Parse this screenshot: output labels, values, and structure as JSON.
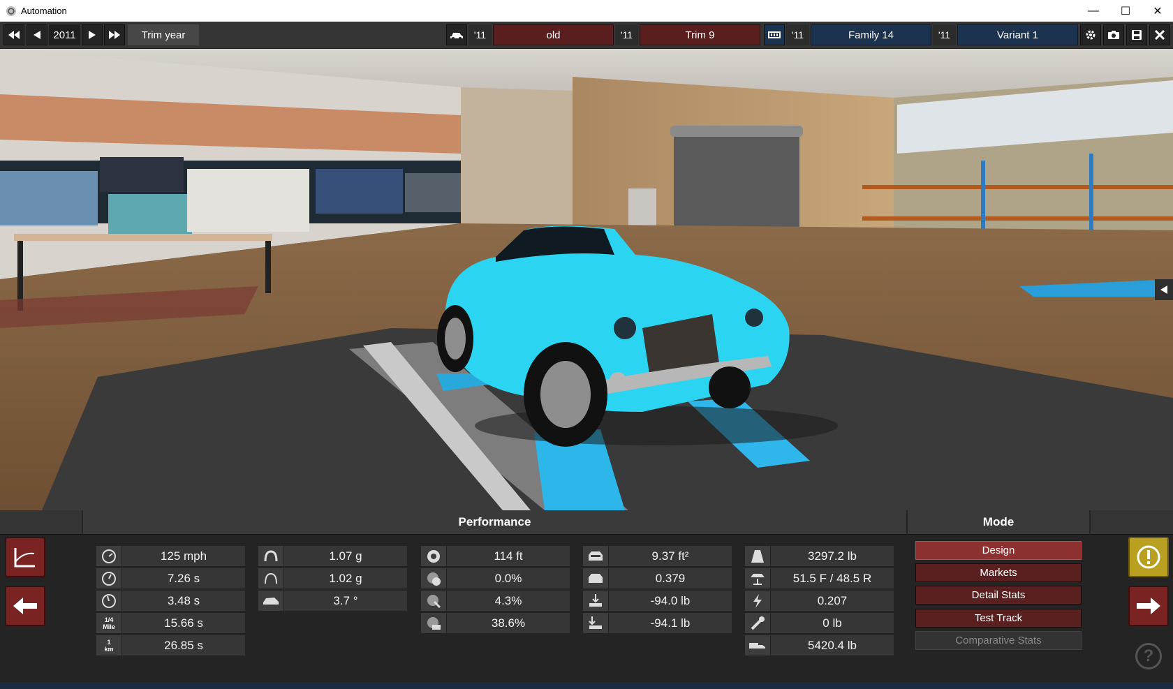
{
  "window": {
    "title": "Automation",
    "controls": {
      "minimize": "—",
      "maximize": "☐",
      "close": "✕"
    }
  },
  "toolbar": {
    "year": "2011",
    "trim_year_label": "Trim year",
    "tags": {
      "t1": "'11",
      "t2": "'11",
      "t3": "'11",
      "t4": "'11"
    },
    "model": "old",
    "trim": "Trim 9",
    "family": "Family 14",
    "variant": "Variant 1"
  },
  "panel": {
    "performance_title": "Performance",
    "mode_title": "Mode",
    "col1": [
      {
        "icon": "top-speed-icon",
        "value": "125 mph"
      },
      {
        "icon": "acceleration-60-icon",
        "value": "7.26 s"
      },
      {
        "icon": "acceleration-40-icon",
        "value": "3.48 s"
      },
      {
        "icon": "quarter-mile-icon",
        "value": "15.66 s",
        "icon_text": "1/4\nMile"
      },
      {
        "icon": "km-time-icon",
        "value": "26.85 s",
        "icon_text": "1\nkm"
      }
    ],
    "col2": [
      {
        "icon": "lateral-g-icon",
        "value": "1.07 g"
      },
      {
        "icon": "lateral-g-low-icon",
        "value": "1.02 g"
      },
      {
        "icon": "body-roll-icon",
        "value": "3.7 °"
      }
    ],
    "col3": [
      {
        "icon": "braking-distance-icon",
        "value": "114 ft"
      },
      {
        "icon": "understeer-icon",
        "value": "0.0%"
      },
      {
        "icon": "brake-fade-icon",
        "value": "4.3%"
      },
      {
        "icon": "wheel-grip-icon",
        "value": "38.6%"
      }
    ],
    "col4": [
      {
        "icon": "frontal-area-icon",
        "value": "9.37 ft²"
      },
      {
        "icon": "drag-coefficient-icon",
        "value": "0.379"
      },
      {
        "icon": "front-downforce-icon",
        "value": "-94.0 lb"
      },
      {
        "icon": "rear-downforce-icon",
        "value": "-94.1 lb"
      }
    ],
    "col5": [
      {
        "icon": "weight-icon",
        "value": "3297.2 lb"
      },
      {
        "icon": "weight-distribution-icon",
        "value": "51.5 F / 48.5 R"
      },
      {
        "icon": "power-to-weight-icon",
        "value": "0.207"
      },
      {
        "icon": "towing-icon",
        "value": "0 lb"
      },
      {
        "icon": "cargo-icon",
        "value": "5420.4 lb"
      }
    ],
    "mode_buttons": [
      "Design",
      "Markets",
      "Detail Stats",
      "Test Track",
      "Comparative Stats"
    ]
  },
  "colors": {
    "accent_red": "#8d3030",
    "blue_header": "#1c3350",
    "warning_yellow": "#b9a021",
    "car_cyan": "#2bd4f0"
  }
}
